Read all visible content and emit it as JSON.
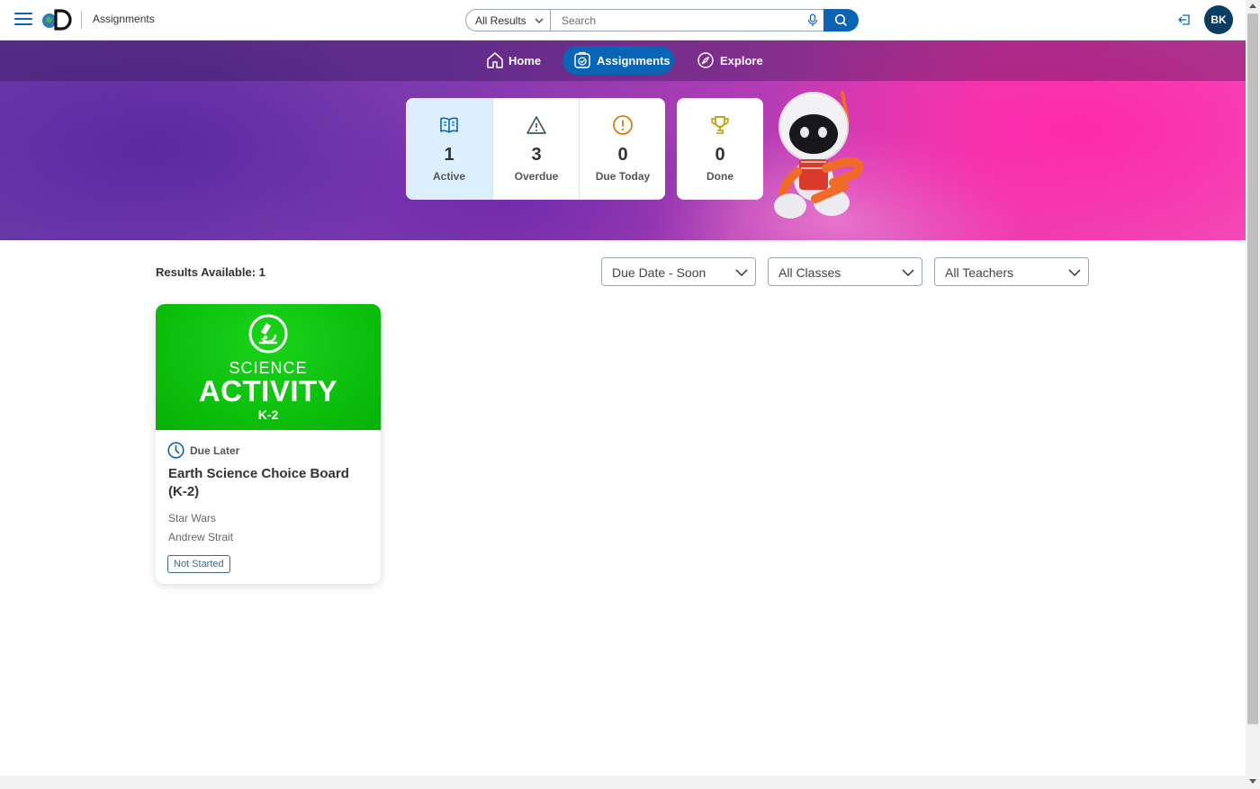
{
  "header": {
    "page_title": "Assignments",
    "search_scope": "All Results",
    "search_placeholder": "Search",
    "avatar_initials": "BK",
    "brand_color": "#0a64b4"
  },
  "nav": {
    "items": [
      {
        "label": "Home",
        "icon": "home-icon",
        "active": false
      },
      {
        "label": "Assignments",
        "icon": "assignment-icon",
        "active": true
      },
      {
        "label": "Explore",
        "icon": "compass-icon",
        "active": false
      }
    ]
  },
  "stats": [
    {
      "count": "1",
      "label": "Active",
      "icon": "book-icon",
      "color": "#0a64b4"
    },
    {
      "count": "3",
      "label": "Overdue",
      "icon": "warning-icon",
      "color": "#3d5a6c"
    },
    {
      "count": "0",
      "label": "Due Today",
      "icon": "alert-circle-icon",
      "color": "#d4800a"
    },
    {
      "count": "0",
      "label": "Done",
      "icon": "trophy-icon",
      "color": "#b89a00"
    }
  ],
  "results": {
    "label": "Results Available: 1"
  },
  "filters": {
    "sort": "Due Date - Soon",
    "classes": "All Classes",
    "teachers": "All Teachers"
  },
  "card": {
    "thumb_line1": "SCIENCE",
    "thumb_line2": "ACTIVITY",
    "thumb_line3": "K-2",
    "due_label": "Due Later",
    "title": "Earth Science Choice Board (K-2)",
    "class_name": "Star Wars",
    "teacher": "Andrew Strait",
    "status": "Not Started"
  }
}
